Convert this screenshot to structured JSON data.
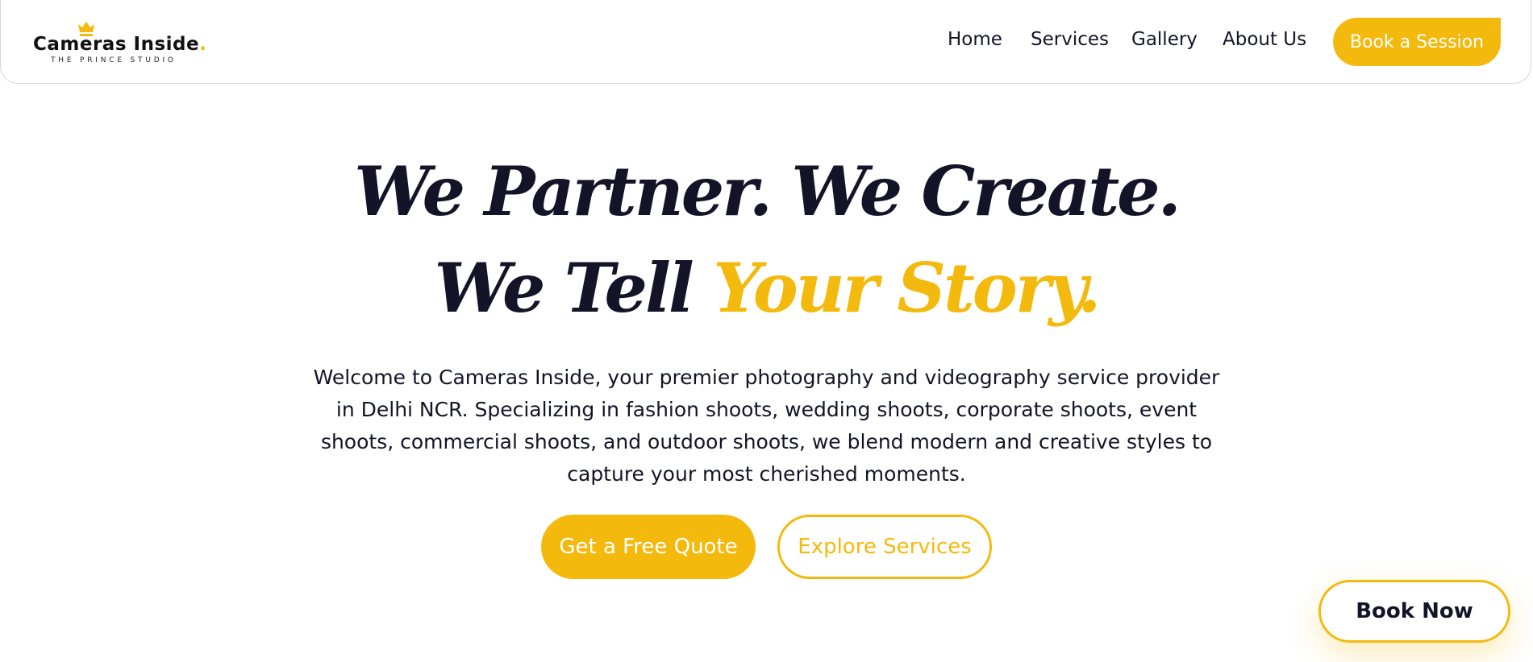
{
  "brand": {
    "name": "Cameras Inside",
    "dot": ".",
    "tagline": "THE PRINCE STUDIO",
    "logo_icon": "crown-icon",
    "accent_color": "#f4b90d"
  },
  "nav": {
    "items": [
      "Home",
      "Services",
      "Gallery",
      "About Us"
    ],
    "cta": "Book a Session"
  },
  "hero": {
    "line1": "We Partner. We Create.",
    "line2_start": "We Tell ",
    "line2_accent": "Your Story.",
    "description": "Welcome to Cameras Inside, your premier photography and videography service provider in Delhi NCR. Specializing in fashion shoots, wedding shoots, corporate shoots, event shoots, commercial shoots, and outdoor shoots, we blend modern and creative styles to capture your most cherished moments.",
    "primary_cta": "Get a Free Quote",
    "secondary_cta": "Explore Services"
  },
  "floating": {
    "book_now": "Book Now"
  }
}
